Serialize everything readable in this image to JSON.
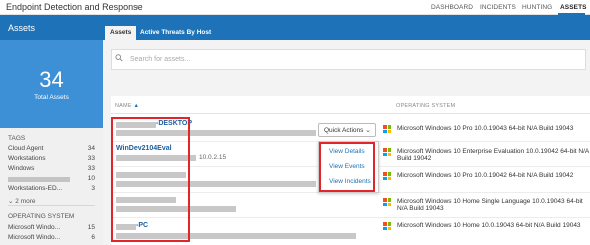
{
  "header": {
    "app_title": "Endpoint Detection and Response",
    "nav": [
      "DASHBOARD",
      "INCIDENTS",
      "HUNTING",
      "ASSETS"
    ],
    "active_nav": "ASSETS"
  },
  "sidebar": {
    "title": "Assets",
    "total_count": "34",
    "total_label": "Total Assets",
    "tags_heading": "TAGS",
    "tags": [
      {
        "label": "Cloud Agent",
        "count": "34"
      },
      {
        "label": "Workstations",
        "count": "33"
      },
      {
        "label": "Windows",
        "count": "33"
      },
      {
        "label": "",
        "count": "10"
      },
      {
        "label": "Workstations-ED...",
        "count": "3"
      }
    ],
    "more_label": "2 more",
    "os_heading": "OPERATING SYSTEM",
    "os": [
      {
        "label": "Microsoft Windo...",
        "count": "15"
      },
      {
        "label": "Microsoft Windo...",
        "count": "6"
      }
    ]
  },
  "tabs": [
    "Assets",
    "Active Threats By Host"
  ],
  "search": {
    "placeholder": "Search for assets..."
  },
  "table": {
    "col_name": "NAME",
    "sort_indicator": "▲",
    "col_os": "OPERATING SYSTEM",
    "rows": [
      {
        "name": "-DESKTOP",
        "ip": "",
        "os": "Microsoft Windows 10 Pro 10.0.19043 64-bit N/A Build 19043"
      },
      {
        "name": "WinDev2104Eval",
        "ip": "10.0.2.15",
        "os": "Microsoft Windows 10 Enterprise Evaluation 10.0.19042 64-bit N/A Build 19042"
      },
      {
        "name": "",
        "ip": "",
        "os": "Microsoft Windows 10 Pro 10.0.19042 64-bit N/A Build 19042"
      },
      {
        "name": "",
        "ip": "",
        "os": "Microsoft Windows 10 Home Single Language 10.0.19043 64-bit N/A Build 19043"
      },
      {
        "name": "-PC",
        "ip": "",
        "os": "Microsoft Windows 10 Home 10.0.19043 64-bit N/A Build 19043"
      }
    ]
  },
  "quick_actions": {
    "label": "Quick Actions",
    "items": [
      "View Details",
      "View Events",
      "View Incidents"
    ]
  },
  "colors": {
    "accent": "#1e73b8",
    "highlight": "#e0262b"
  }
}
